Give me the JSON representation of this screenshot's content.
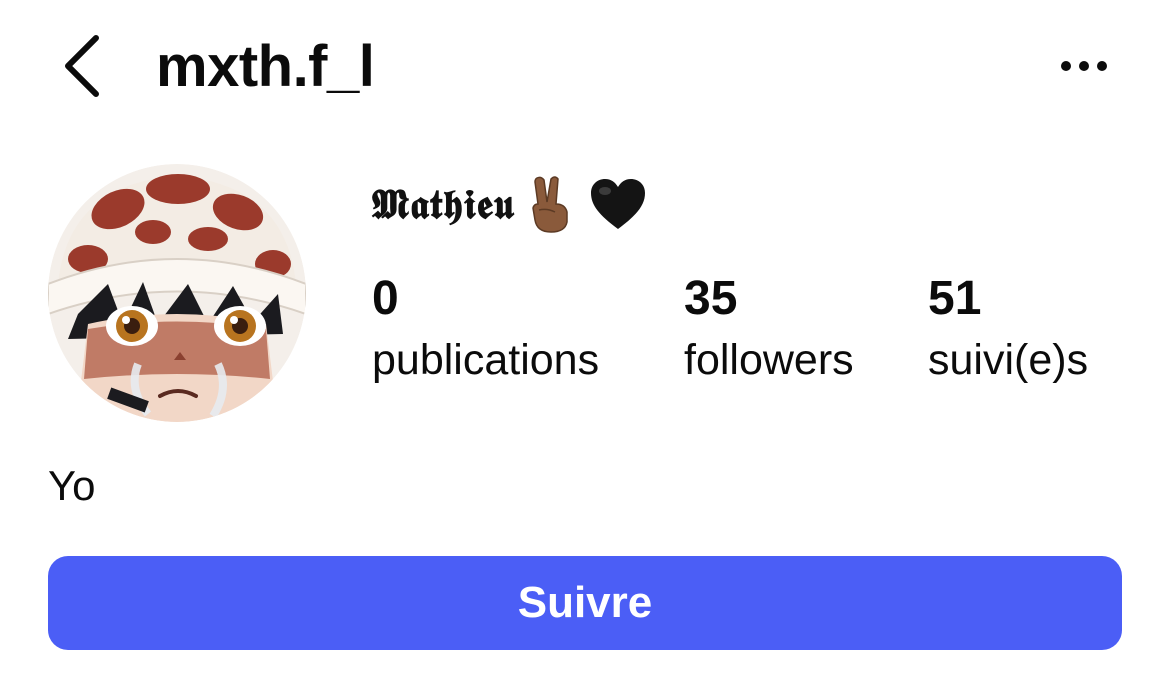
{
  "header": {
    "username": "mxth.f_l",
    "back_icon": "chevron-left-icon",
    "more_icon": "ellipsis-horizontal-icon"
  },
  "profile": {
    "display_name": "𝕸𝖆𝖙𝖍𝖎𝖊𝖚",
    "display_name_emojis": [
      "victory-hand-emoji",
      "black-heart-emoji"
    ],
    "avatar_description": "avatar-image",
    "stats": [
      {
        "value": "0",
        "label": "publications"
      },
      {
        "value": "35",
        "label": "followers"
      },
      {
        "value": "51",
        "label": "suivi(e)s"
      }
    ],
    "bio": "Yo"
  },
  "actions": {
    "follow_label": "Suivre"
  },
  "colors": {
    "accent": "#4b5ef6",
    "text": "#0b0b0b",
    "background": "#ffffff"
  }
}
